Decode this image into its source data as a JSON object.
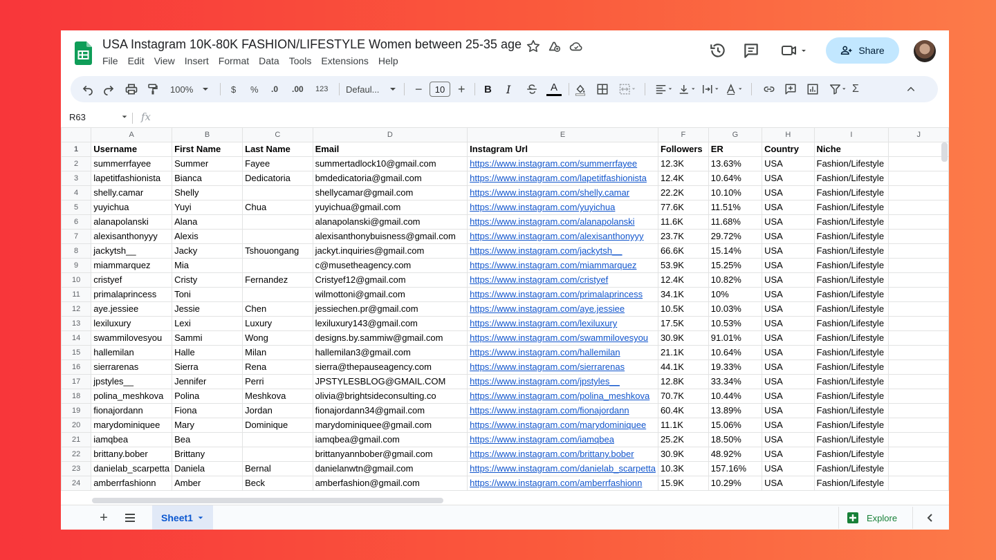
{
  "doc": {
    "title": "USA Instagram 10K-80K FASHION/LIFESTYLE Women between 25-35 age",
    "menu": [
      "File",
      "Edit",
      "View",
      "Insert",
      "Format",
      "Data",
      "Tools",
      "Extensions",
      "Help"
    ],
    "share_label": "Share"
  },
  "toolbar": {
    "zoom": "100%",
    "currency": "$",
    "percent": "%",
    "dec_decrease": ".0",
    "dec_increase": ".00",
    "number_format": "123",
    "font": "Defaul...",
    "font_size": "10",
    "bold": "B",
    "italic": "I",
    "text_color_glyph": "A",
    "sum_glyph": "Σ"
  },
  "formula_bar": {
    "cell_ref": "R63",
    "fx": "fx"
  },
  "columns": [
    "A",
    "B",
    "C",
    "D",
    "E",
    "F",
    "G",
    "H",
    "I",
    "J"
  ],
  "headers": [
    "Username",
    "First Name",
    "Last Name",
    "Email",
    "Instagram Url",
    "Followers",
    "ER",
    "Country",
    "Niche"
  ],
  "rows": [
    [
      "summerrfayee",
      "Summer",
      "Fayee",
      "summertadlock10@gmail.com",
      "https://www.instagram.com/summerrfayee",
      "12.3K",
      "13.63%",
      "USA",
      "Fashion/Lifestyle"
    ],
    [
      "lapetitfashionista",
      "Bianca",
      "Dedicatoria",
      "bmdedicatoria@gmail.com",
      "https://www.instagram.com/lapetitfashionista",
      "12.4K",
      "10.64%",
      "USA",
      "Fashion/Lifestyle"
    ],
    [
      "shelly.camar",
      "Shelly",
      "",
      "shellycamar@gmail.com",
      "https://www.instagram.com/shelly.camar",
      "22.2K",
      "10.10%",
      "USA",
      "Fashion/Lifestyle"
    ],
    [
      "yuyichua",
      "Yuyi",
      "Chua",
      "yuyichua@gmail.com",
      "https://www.instagram.com/yuyichua",
      "77.6K",
      "11.51%",
      "USA",
      "Fashion/Lifestyle"
    ],
    [
      "alanapolanski",
      "Alana",
      "",
      "alanapolanski@gmail.com",
      "https://www.instagram.com/alanapolanski",
      "11.6K",
      "11.68%",
      "USA",
      "Fashion/Lifestyle"
    ],
    [
      "alexisanthonyyy",
      "Alexis",
      "",
      "alexisanthonybuisness@gmail.com",
      "https://www.instagram.com/alexisanthonyyy",
      "23.7K",
      "29.72%",
      "USA",
      "Fashion/Lifestyle"
    ],
    [
      "jackytsh__",
      "Jacky",
      "Tshouongang",
      "jackyt.inquiries@gmail.com",
      "https://www.instagram.com/jackytsh__",
      "66.6K",
      "15.14%",
      "USA",
      "Fashion/Lifestyle"
    ],
    [
      "miammarquez",
      "Mia",
      "",
      "c@musetheagency.com",
      "https://www.instagram.com/miammarquez",
      "53.9K",
      "15.25%",
      "USA",
      "Fashion/Lifestyle"
    ],
    [
      "cristyef",
      "Cristy",
      "Fernandez",
      "Cristyef12@gmail.com",
      "https://www.instagram.com/cristyef",
      "12.4K",
      "10.82%",
      "USA",
      "Fashion/Lifestyle"
    ],
    [
      "primalaprincess",
      "Toni",
      "",
      "wilmottoni@gmail.com",
      "https://www.instagram.com/primalaprincess",
      "34.1K",
      "10%",
      "USA",
      "Fashion/Lifestyle"
    ],
    [
      "aye.jessiee",
      "Jessie",
      "Chen",
      "jessiechen.pr@gmail.com",
      "https://www.instagram.com/aye.jessiee",
      "10.5K",
      "10.03%",
      "USA",
      "Fashion/Lifestyle"
    ],
    [
      "lexiluxury",
      "Lexi",
      "Luxury",
      "lexiluxury143@gmail.com",
      "https://www.instagram.com/lexiluxury",
      "17.5K",
      "10.53%",
      "USA",
      "Fashion/Lifestyle"
    ],
    [
      "swammilovesyou",
      "Sammi",
      "Wong",
      "designs.by.sammiw@gmail.com",
      "https://www.instagram.com/swammilovesyou",
      "30.9K",
      "91.01%",
      "USA",
      "Fashion/Lifestyle"
    ],
    [
      "hallemilan",
      "Halle",
      "Milan",
      "hallemilan3@gmail.com",
      "https://www.instagram.com/hallemilan",
      "21.1K",
      "10.64%",
      "USA",
      "Fashion/Lifestyle"
    ],
    [
      "sierrarenas",
      "Sierra",
      "Rena",
      "sierra@thepauseagency.com",
      "https://www.instagram.com/sierrarenas",
      "44.1K",
      "19.33%",
      "USA",
      "Fashion/Lifestyle"
    ],
    [
      "jpstyles__",
      "Jennifer",
      "Perri",
      "JPSTYLESBLOG@GMAIL.COM",
      "https://www.instagram.com/jpstyles__",
      "12.8K",
      "33.34%",
      "USA",
      "Fashion/Lifestyle"
    ],
    [
      "polina_meshkova",
      "Polina",
      "Meshkova",
      "olivia@brightsideconsulting.co",
      "https://www.instagram.com/polina_meshkova",
      "70.7K",
      "10.44%",
      "USA",
      "Fashion/Lifestyle"
    ],
    [
      "fionajordann",
      "Fiona",
      "Jordan",
      "fionajordann34@gmail.com",
      "https://www.instagram.com/fionajordann",
      "60.4K",
      "13.89%",
      "USA",
      "Fashion/Lifestyle"
    ],
    [
      "marydominiquee",
      "Mary",
      "Dominique",
      "marydominiquee@gmail.com",
      "https://www.instagram.com/marydominiquee",
      "11.1K",
      "15.06%",
      "USA",
      "Fashion/Lifestyle"
    ],
    [
      "iamqbea",
      "Bea",
      "",
      "iamqbea@gmail.com",
      "https://www.instagram.com/iamqbea",
      "25.2K",
      "18.50%",
      "USA",
      "Fashion/Lifestyle"
    ],
    [
      "brittany.bober",
      "Brittany",
      "",
      "brittanyannbober@gmail.com",
      "https://www.instagram.com/brittany.bober",
      "30.9K",
      "48.92%",
      "USA",
      "Fashion/Lifestyle"
    ],
    [
      "danielab_scarpetta",
      "Daniela",
      "Bernal",
      "danielanwtn@gmail.com",
      "https://www.instagram.com/danielab_scarpetta",
      "10.3K",
      "157.16%",
      "USA",
      "Fashion/Lifestyle"
    ],
    [
      "amberrfashionn",
      "Amber",
      "Beck",
      "amberfashion@gmail.com",
      "https://www.instagram.com/amberrfashionn",
      "15.9K",
      "10.29%",
      "USA",
      "Fashion/Lifestyle"
    ]
  ],
  "sheet_tab": "Sheet1",
  "explore_label": "Explore",
  "colors": {
    "accent": "#0b57d0",
    "link": "#1155cc",
    "share_bg": "#c2e7ff",
    "logo": "#0f9d58"
  }
}
